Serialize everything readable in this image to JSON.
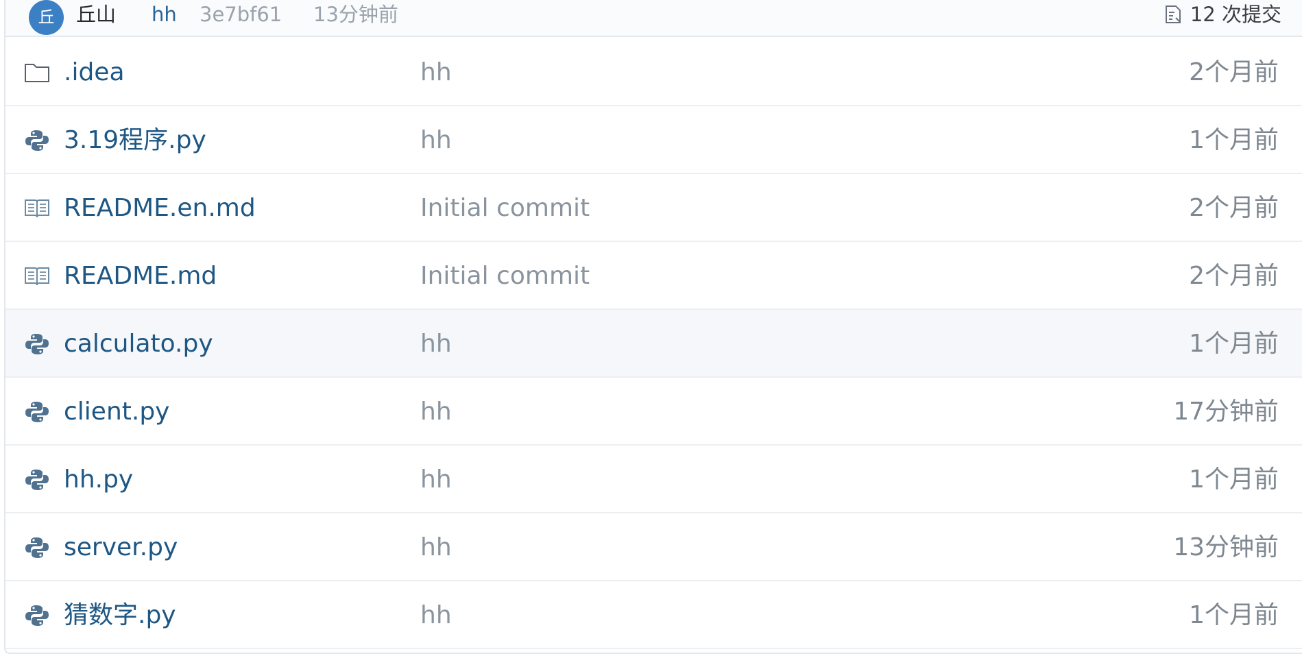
{
  "latest_commit": {
    "avatar_text": "丘",
    "author": "丘山",
    "message": "hh",
    "hash": "3e7bf61",
    "time": "13分钟前",
    "commits_label": "12 次提交"
  },
  "colors": {
    "link": "#1e5784",
    "muted": "#8a949e",
    "avatar_bg": "#3b7fc4",
    "row_highlight": "#f5f7fa"
  },
  "files": [
    {
      "icon": "folder-icon",
      "name": ".idea",
      "message": "hh",
      "time": "2个月前"
    },
    {
      "icon": "python-icon",
      "name": "3.19程序.py",
      "message": "hh",
      "time": "1个月前"
    },
    {
      "icon": "book-icon",
      "name": "README.en.md",
      "message": "Initial commit",
      "time": "2个月前"
    },
    {
      "icon": "book-icon",
      "name": "README.md",
      "message": "Initial commit",
      "time": "2个月前"
    },
    {
      "icon": "python-icon",
      "name": "calculato.py",
      "message": "hh",
      "time": "1个月前",
      "highlighted": true
    },
    {
      "icon": "python-icon",
      "name": "client.py",
      "message": "hh",
      "time": "17分钟前"
    },
    {
      "icon": "python-icon",
      "name": "hh.py",
      "message": "hh",
      "time": "1个月前"
    },
    {
      "icon": "python-icon",
      "name": "server.py",
      "message": "hh",
      "time": "13分钟前"
    },
    {
      "icon": "python-icon",
      "name": "猜数字.py",
      "message": "hh",
      "time": "1个月前"
    }
  ]
}
